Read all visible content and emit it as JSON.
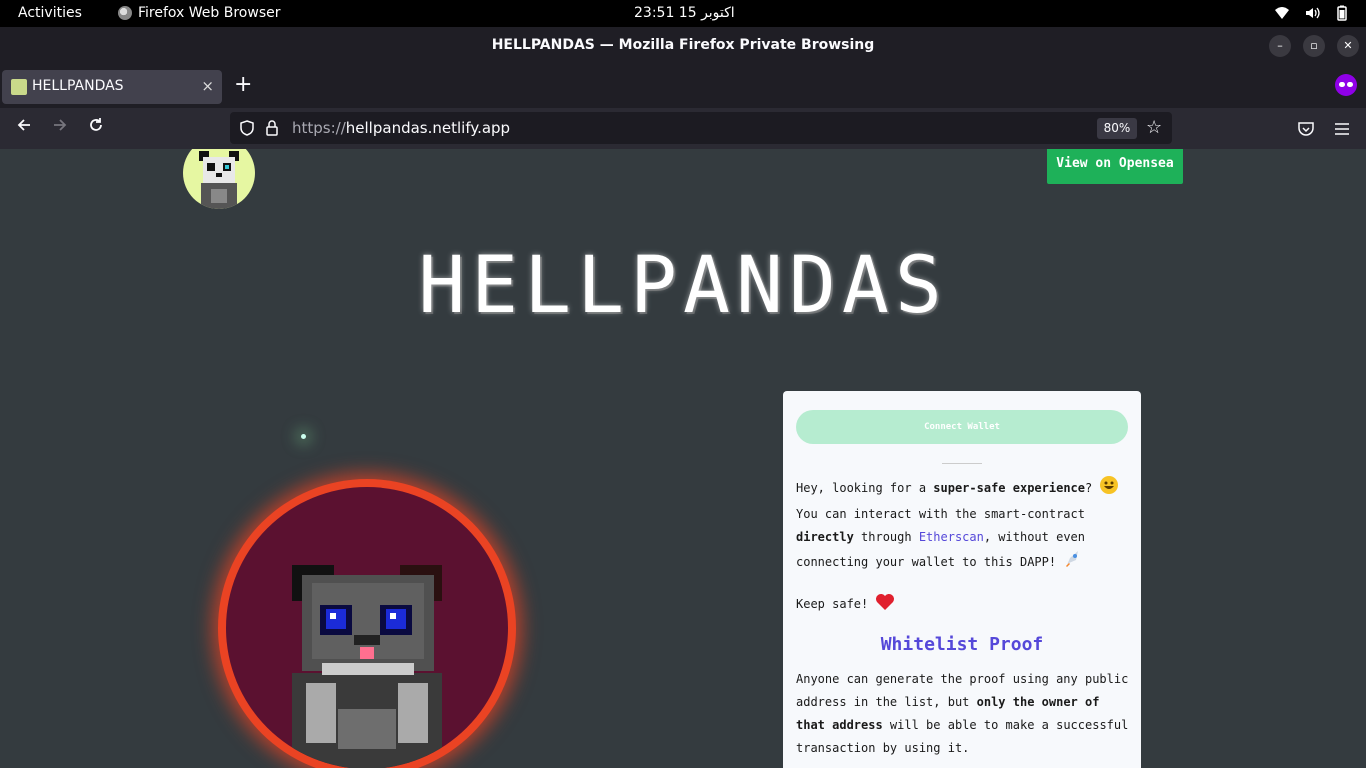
{
  "system_bar": {
    "activities": "Activities",
    "app_name": "Firefox Web Browser",
    "clock": "23:51  15 اکتوبر"
  },
  "window": {
    "title": "HELLPANDAS — Mozilla Firefox Private Browsing",
    "minimize": "–",
    "maximize": "▫",
    "close": "✕"
  },
  "tabs": [
    {
      "label": "HELLPANDAS",
      "close": "×"
    }
  ],
  "new_tab": "+",
  "navbar": {
    "url_protocol": "https://",
    "url_host": "hellpandas.netlify.app",
    "zoom": "80%"
  },
  "page": {
    "opensea_button": "View on Opensea",
    "hero_title": "HELLPANDAS",
    "card": {
      "connect_wallet": "Connect Wallet",
      "para1_a": "Hey, looking for a ",
      "para1_b": "super-safe experience",
      "para1_c": "? ",
      "para1_d": "You can interact with the smart-contract ",
      "para1_e": "directly",
      "para1_f": " through ",
      "para1_link": "Etherscan",
      "para1_g": ", without even connecting your wallet to this DAPP! ",
      "keep_safe": "Keep safe! ",
      "whitelist_title": "Whitelist Proof",
      "para2_a": "Anyone can generate the proof using any public address in the list, but ",
      "para2_b": "only the owner of that address",
      "para2_c": " will be able to make a successful transaction by using it."
    }
  },
  "colors": {
    "page_bg": "#343b3f",
    "accent_green": "#1eb159",
    "accent_purple": "#5548d9",
    "ring_red": "#ea4323"
  }
}
